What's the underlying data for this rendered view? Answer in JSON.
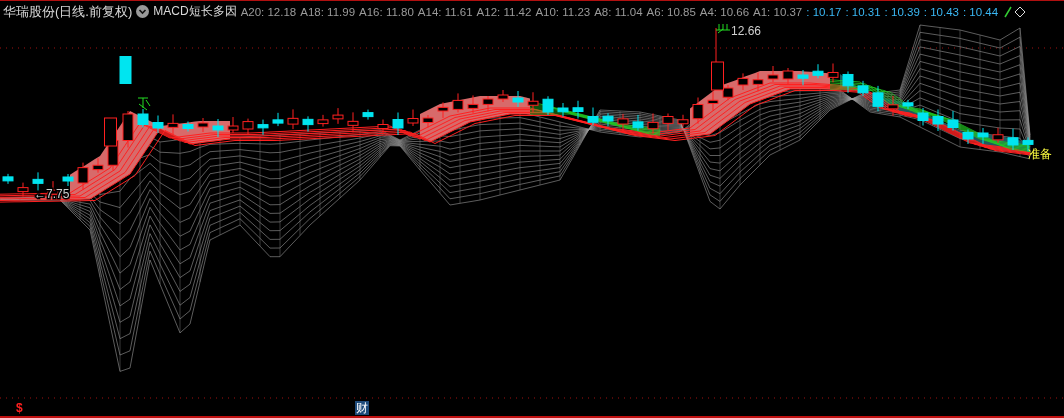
{
  "header": {
    "title": "华瑞股份(日线.前复权)",
    "indicator": "MACD短长多因",
    "values": [
      {
        "label": "A20: 12.18",
        "kind": "average"
      },
      {
        "label": "A18: 11.99",
        "kind": "average"
      },
      {
        "label": "A16: 11.80",
        "kind": "average"
      },
      {
        "label": "A14: 11.61",
        "kind": "average"
      },
      {
        "label": "A12: 11.42",
        "kind": "average"
      },
      {
        "label": "A10: 11.23",
        "kind": "average"
      },
      {
        "label": "A8: 11.04",
        "kind": "average"
      },
      {
        "label": "A6: 10.85",
        "kind": "average"
      },
      {
        "label": "A4: 10.66",
        "kind": "average"
      },
      {
        "label": "A1: 10.37",
        "kind": "average"
      },
      {
        "label": ": 10.17",
        "kind": "current"
      },
      {
        "label": ": 10.31",
        "kind": "current"
      },
      {
        "label": ": 10.39",
        "kind": "current"
      },
      {
        "label": ": 10.43",
        "kind": "current"
      },
      {
        "label": ": 10.44",
        "kind": "current"
      }
    ]
  },
  "chart": {
    "high_label": "12.66",
    "low_label": "←7.75",
    "signal_label": "准备"
  },
  "footer": {
    "markers": [
      {
        "text": "$",
        "kind": "dividend"
      },
      {
        "text": "财",
        "kind": "finance"
      }
    ]
  }
}
